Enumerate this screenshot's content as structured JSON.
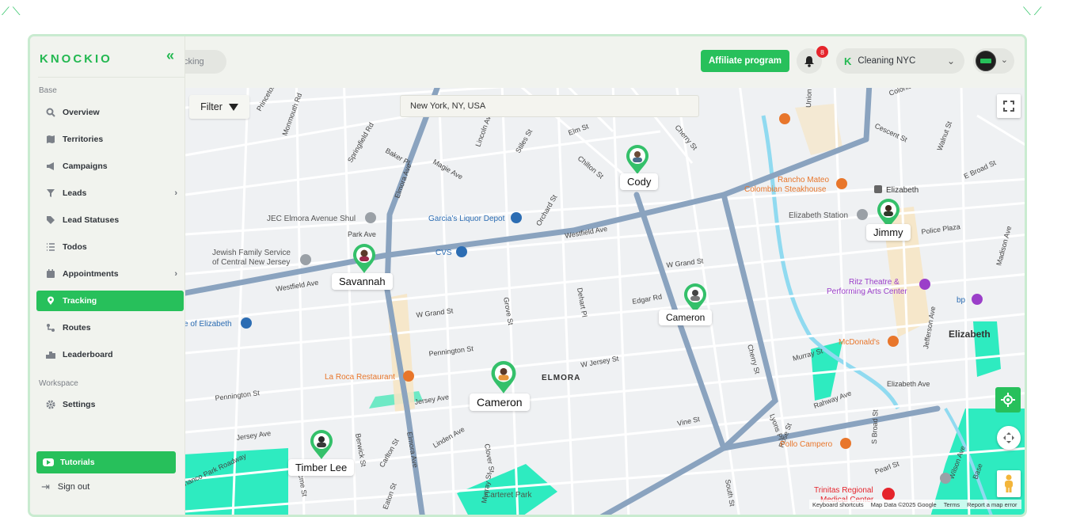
{
  "brand": {
    "logo_text": "KNOCKIO",
    "accent": "#27c05b"
  },
  "sidebar": {
    "collapse_icon": "double-chevron-left-icon",
    "section_base": "Base",
    "section_workspace": "Workspace",
    "items": [
      {
        "label": "Overview",
        "icon": "magnifier-icon"
      },
      {
        "label": "Territories",
        "icon": "map-icon"
      },
      {
        "label": "Campaigns",
        "icon": "megaphone-icon"
      },
      {
        "label": "Leads",
        "icon": "filter-icon"
      },
      {
        "label": "Lead Statuses",
        "icon": "tag-icon"
      },
      {
        "label": "Todos",
        "icon": "list-icon"
      },
      {
        "label": "Appointments",
        "icon": "calendar-icon"
      },
      {
        "label": "Tracking",
        "icon": "location-pin-icon"
      },
      {
        "label": "Routes",
        "icon": "route-icon"
      },
      {
        "label": "Leaderboard",
        "icon": "podium-icon"
      }
    ],
    "settings_label": "Settings",
    "tutorials_label": "Tutorials",
    "signout_label": "Sign out"
  },
  "topbar": {
    "search_text": "cking",
    "affiliate_label": "Affiliate program",
    "notifications_count": "8",
    "workspace_name": "Cleaning NYC",
    "workspace_initial": "K"
  },
  "map": {
    "filter_label": "Filter",
    "location_value": "New York, NY, USA",
    "attribution": {
      "shortcuts": "Keyboard shortcuts",
      "data": "Map Data ©2025 Google",
      "terms": "Terms",
      "report": "Report a map error"
    },
    "places": {
      "garcias": "Garcia's Liquor Depot",
      "cvs": "CVS",
      "jec": "JEC Elmora Avenue Shul",
      "jewish1": "Jewish Family Service",
      "jewish2": "of Central New Jersey",
      "elizabeth_store": "e of Elizabeth",
      "la_roca": "La Roca Restaurant",
      "rancho1": "Rancho Mateo",
      "rancho2": "Colombian Steakhouse",
      "elizabeth_station": "Elizabeth Station",
      "elizabeth_stop": "Elizabeth",
      "ritz1": "Ritz Theatre &",
      "ritz2": "Performing Arts Center",
      "mcdonalds": "McDonald's",
      "pollo": "Pollo Campero",
      "trinitas1": "Trinitas Regional",
      "trinitas2": "Medical Center",
      "carteret": "Carteret Park",
      "elmora": "ELMORA",
      "elizabeth_city": "Elizabeth",
      "bp": "bp"
    },
    "streets": {
      "westfield1": "Westfield Ave",
      "westfield2": "Westfield Ave",
      "grand1": "W Grand St",
      "grand2": "W Grand St",
      "jersey1": "W Jersey St",
      "jersey2": "Jersey Ave",
      "jersey3": "Jersey Ave",
      "pennington1": "Pennington St",
      "pennington2": "Pennington St",
      "elmora1": "Elmora Ave",
      "elmora2": "Elmora Ave",
      "magie": "Magie Ave",
      "chilton": "Chilton St",
      "orchard": "Orchard St",
      "cherry1": "Cherry St",
      "cherry2": "Cherry St",
      "murray1": "Murray St",
      "murray2": "Murray St",
      "edgar": "Edgar Rd",
      "vine": "Vine St",
      "rahway": "Rahway Ave",
      "elizabeth_ave": "Elizabeth Ave",
      "police": "Police Plaza",
      "jefferson": "Jefferson Ave",
      "broad_s": "S Broad St",
      "broad_e": "E Broad St",
      "madison": "Madison Ave",
      "park": "Park Ave",
      "linden": "Linden Ave",
      "grove": "Grove St",
      "dehart": "Dehart Pl",
      "springfield": "Springfield Rd",
      "baker": "Baker Pl",
      "monmouth": "Monmouth Rd",
      "stiles": "Stiles St",
      "lincoln": "Lincoln Ave",
      "elm": "Elm St",
      "cescent": "Cescent St",
      "walnut": "Walnut St",
      "pearl": "Pearl St",
      "lyons": "Lyons Pl",
      "clover": "Clover St",
      "murray_s": "Murray St",
      "south": "South St",
      "acme": "Acme St",
      "berwick": "Berwick St",
      "carlton": "Carlton St",
      "eaton": "Eaton St",
      "roadway": "nanco Park Roadway",
      "pennington_sm": "Pennington St",
      "rose": "Rose St",
      "palmer": "Palmer St",
      "union": "Union",
      "base": "Base",
      "wilson": "Wilson Ave",
      "colonia": "Colonia Rd",
      "princeton": "Princeton"
    },
    "people": [
      {
        "name": "Cody"
      },
      {
        "name": "Jimmy"
      },
      {
        "name": "Savannah"
      },
      {
        "name": "Cameron"
      },
      {
        "name": "Cameron"
      },
      {
        "name": "Timber Lee"
      }
    ]
  }
}
